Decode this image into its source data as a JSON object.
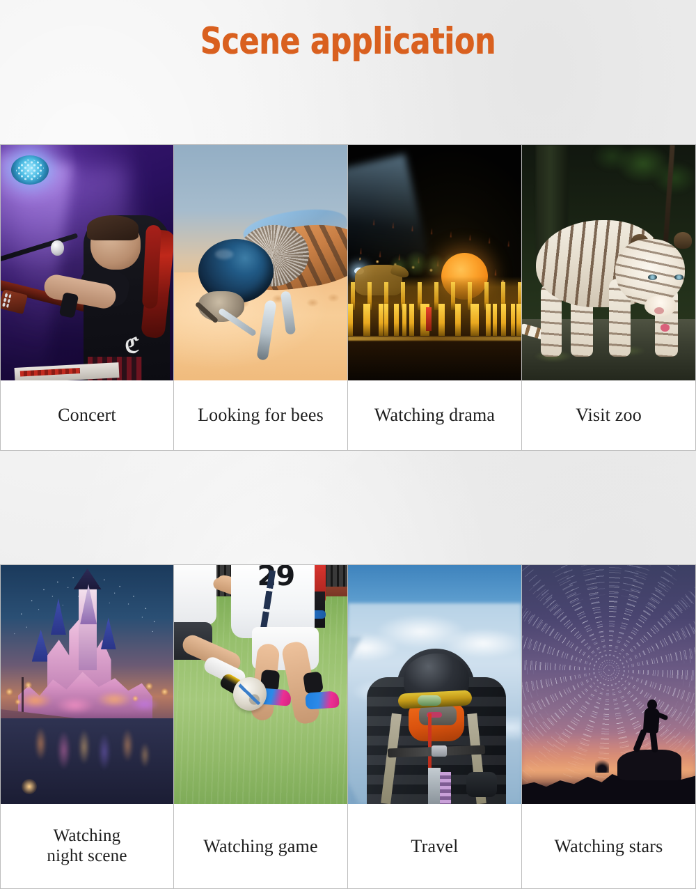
{
  "page": {
    "title": "Scene application",
    "background_color": "#eeeeee",
    "title_color": "#d9601f",
    "card_background": "#ffffff",
    "card_border_color": "#bdbdbd",
    "caption_color": "#1d1d1d"
  },
  "grid": {
    "rows": [
      {
        "row_index": 1,
        "cards": [
          {
            "caption": "Concert",
            "image": "concert-stage-guitarist-photo"
          },
          {
            "caption": "Looking for bees",
            "image": "bee-macro-closeup-photo"
          },
          {
            "caption": "Watching drama",
            "image": "outdoor-night-theatre-performance-photo"
          },
          {
            "caption": "Visit zoo",
            "image": "white-tiger-in-jungle-photo"
          }
        ]
      },
      {
        "row_index": 2,
        "cards": [
          {
            "caption": "Watching\nnight scene",
            "caption_line_1": "Watching",
            "caption_line_2": "night scene",
            "image": "illuminated-castle-at-dusk-photo"
          },
          {
            "caption": "Watching game",
            "image": "soccer-players-on-turf-photo"
          },
          {
            "caption": "Travel",
            "image": "mountaineer-on-snowy-peak-photo"
          },
          {
            "caption": "Watching stars",
            "image": "star-trails-night-sky-photo"
          }
        ]
      }
    ]
  },
  "photo_details": {
    "soccer_jersey_number": "29"
  }
}
